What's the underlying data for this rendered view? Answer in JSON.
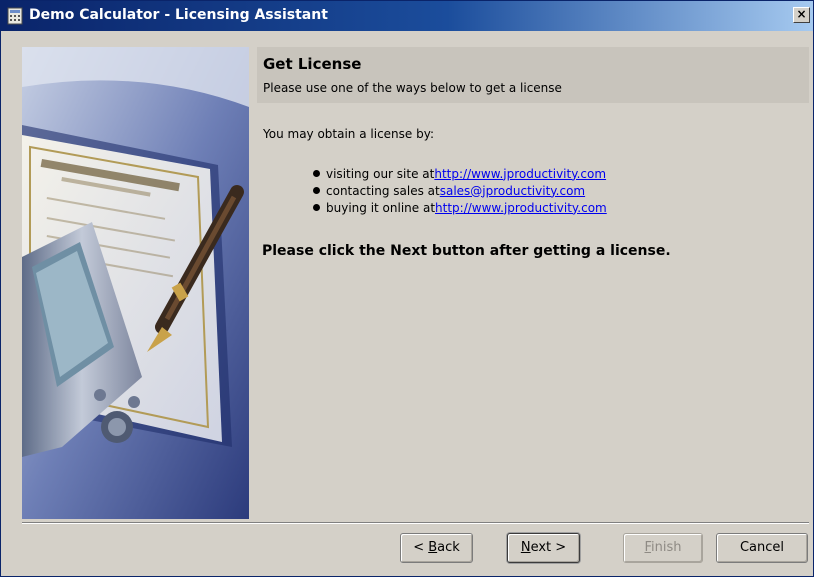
{
  "window": {
    "title": "Demo Calculator - Licensing Assistant",
    "close_label": "×"
  },
  "header": {
    "title": "Get License",
    "subtitle": "Please use one of the ways below to get a license"
  },
  "content": {
    "intro": "You may obtain a license by:",
    "options": [
      {
        "text": "visiting our site at ",
        "link": "http://www.jproductivity.com"
      },
      {
        "text": "contacting sales at ",
        "link": "sales@jproductivity.com"
      },
      {
        "text": "buying it online at ",
        "link": "http://www.jproductivity.com"
      }
    ],
    "emphasis": "Please click the Next button after getting a license."
  },
  "buttons": {
    "back": {
      "prefix": "< ",
      "mnemonic": "B",
      "rest": "ack"
    },
    "next": {
      "mnemonic": "N",
      "rest": "ext >"
    },
    "finish": {
      "mnemonic": "F",
      "rest": "inish"
    },
    "cancel": "Cancel"
  }
}
